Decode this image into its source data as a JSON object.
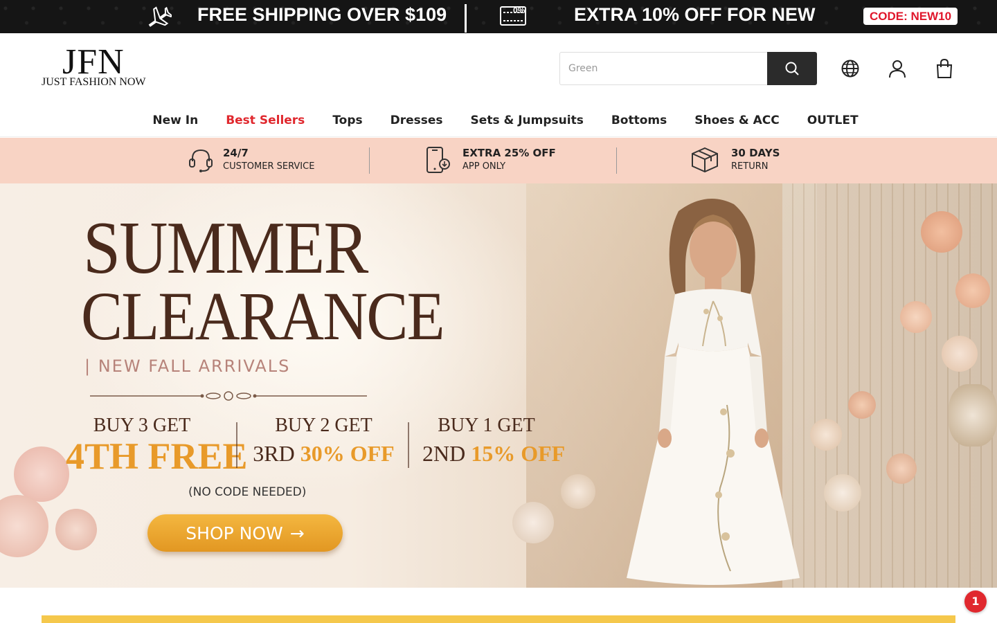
{
  "promo": {
    "shipping": "FREE SHIPPING OVER $109",
    "discount": "EXTRA 10% OFF FOR NEW",
    "code": "CODE: NEW10",
    "coupon_badge": "0%"
  },
  "header": {
    "logo_mark": "JFN",
    "logo_text": "JUST FASHION NOW",
    "search_placeholder": "Green"
  },
  "nav": {
    "items": [
      "New In",
      "Best Sellers",
      "Tops",
      "Dresses",
      "Sets & Jumpsuits",
      "Bottoms",
      "Shoes & ACC",
      "OUTLET"
    ]
  },
  "services": [
    {
      "title": "24/7",
      "subtitle": "CUSTOMER SERVICE",
      "icon": "headset-icon"
    },
    {
      "title": "EXTRA 25% OFF",
      "subtitle": "APP ONLY",
      "icon": "phone-icon"
    },
    {
      "title": "30 DAYS",
      "subtitle": "RETURN",
      "icon": "box-icon"
    }
  ],
  "hero": {
    "title_line1": "SUMMER",
    "title_line2": "CLEARANCE",
    "subtitle": "| NEW FALL ARRIVALS",
    "offers": [
      {
        "line1": "BUY 3 GET",
        "highlight": "4TH FREE",
        "prefix": ""
      },
      {
        "line1": "BUY 2 GET",
        "prefix": "3RD",
        "highlight": "30% OFF"
      },
      {
        "line1": "BUY 1 GET",
        "prefix": "2ND",
        "highlight": "15% OFF"
      }
    ],
    "note": "(NO CODE NEEDED)",
    "cta": "SHOP NOW",
    "cta_arrow": "→"
  },
  "notification": {
    "count": "1"
  },
  "colors": {
    "accent_red": "#e0282e",
    "hero_brown": "#4a2a1c",
    "hero_gold": "#e89a2a",
    "service_bg": "#f8d3c4",
    "promo_bg": "#151515"
  }
}
